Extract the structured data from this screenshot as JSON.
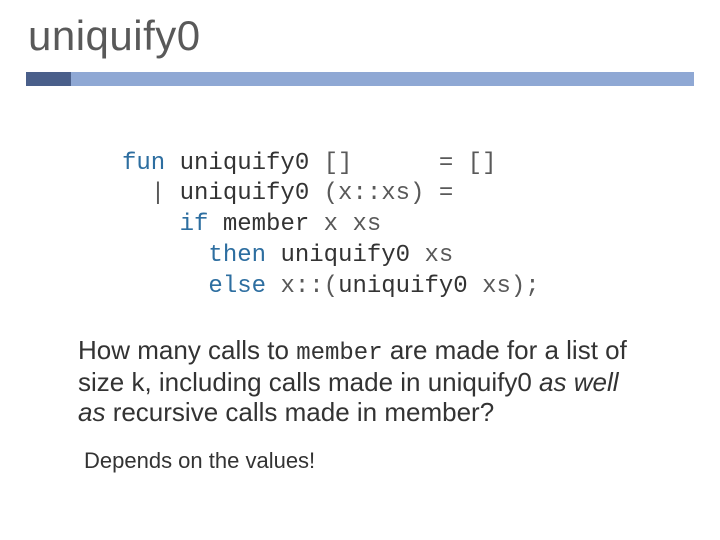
{
  "title": "uniquify0",
  "code": {
    "l1": {
      "kw": "fun ",
      "nm": "uniquify0 ",
      "rest": "[]      = []"
    },
    "l2": {
      "pre": "  | ",
      "nm": "uniquify0 ",
      "rest": "(x::xs) ="
    },
    "l3": {
      "pre": "    ",
      "kw": "if ",
      "nm": "member ",
      "rest": "x xs"
    },
    "l4": {
      "pre": "      ",
      "kw": "then ",
      "nm": "uniquify0 ",
      "rest": "xs"
    },
    "l5": {
      "pre": "      ",
      "kw": "else ",
      "txt": "x::",
      "rest1": "(",
      "nm": "uniquify0 ",
      "rest2": "xs);"
    }
  },
  "question": {
    "p1": "How many calls to ",
    "m1": "member",
    "p2": " are made for a list of size k, including calls made in uniquify0 ",
    "i1": "as well as",
    "p3": " recursive calls made in member?"
  },
  "answer": "Depends on the values!"
}
